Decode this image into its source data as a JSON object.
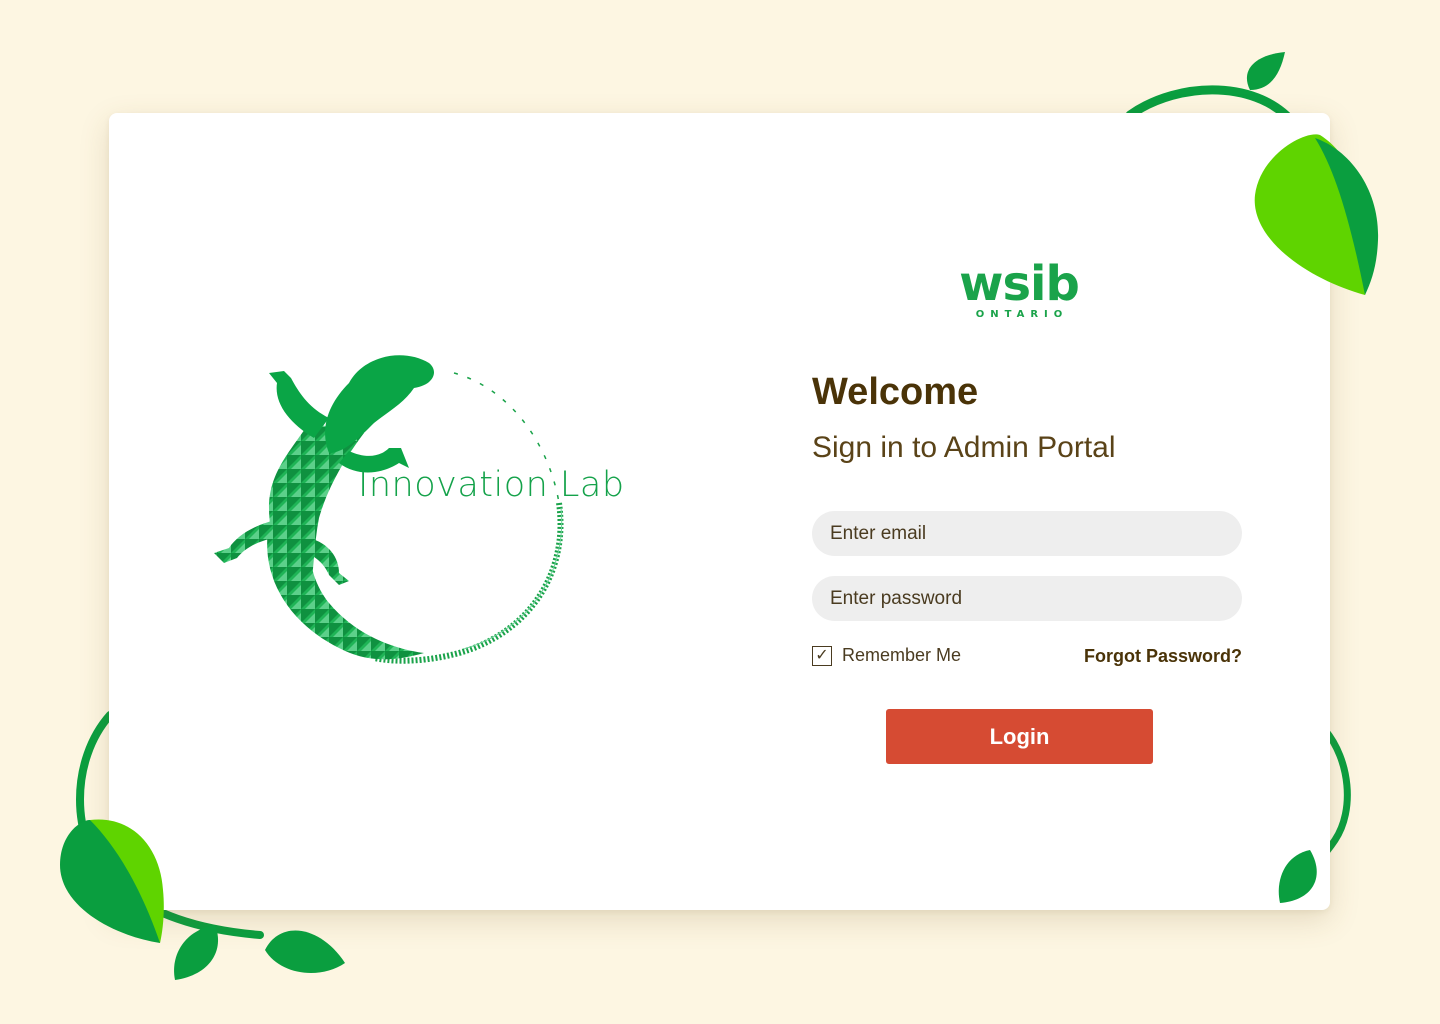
{
  "brand": {
    "wordmark": "wsib",
    "region": "ONTARIO"
  },
  "lab": {
    "name": "Innovation Lab"
  },
  "login": {
    "heading": "Welcome",
    "subheading": "Sign in to Admin Portal",
    "email_placeholder": "Enter email",
    "email_value": "",
    "password_placeholder": "Enter password",
    "password_value": "",
    "remember_label": "Remember Me",
    "remember_checked": true,
    "forgot_label": "Forgot Password?",
    "submit_label": "Login"
  },
  "icons": {
    "checkbox": "checkmark-icon",
    "mascot": "lizard-icon",
    "decor": "vine-leaf-icon"
  },
  "colors": {
    "background": "#fdf6e2",
    "card": "#ffffff",
    "accent_green": "#1aa34a",
    "leaf_light": "#5fd400",
    "text_brown": "#4a3308",
    "input_bg": "#eeeeee",
    "login_button": "#d64b33"
  }
}
